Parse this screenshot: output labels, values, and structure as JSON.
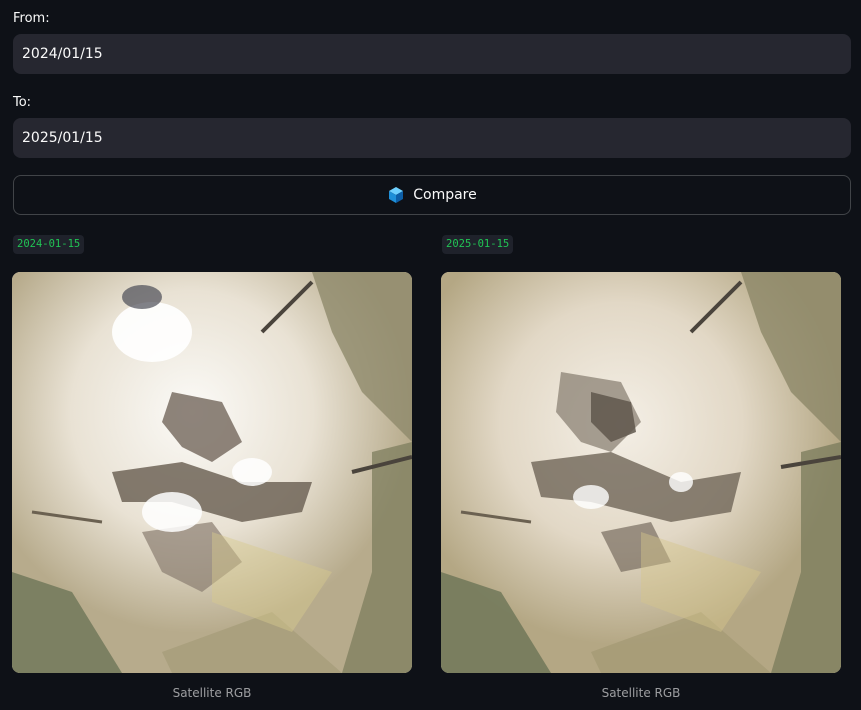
{
  "from_field": {
    "label": "From:",
    "value": "2024/01/15"
  },
  "to_field": {
    "label": "To:",
    "value": "2025/01/15"
  },
  "compare_button": {
    "label": "Compare",
    "icon": "cube-icon"
  },
  "images": [
    {
      "date_tag": "2024-01-15",
      "caption": "Satellite RGB",
      "content": "satellite-image"
    },
    {
      "date_tag": "2025-01-15",
      "caption": "Satellite RGB",
      "content": "satellite-image"
    }
  ],
  "colors": {
    "background": "#0e1117",
    "input_background": "#262730",
    "code_text": "#21c354",
    "caption_text": "#9a9ca1"
  }
}
